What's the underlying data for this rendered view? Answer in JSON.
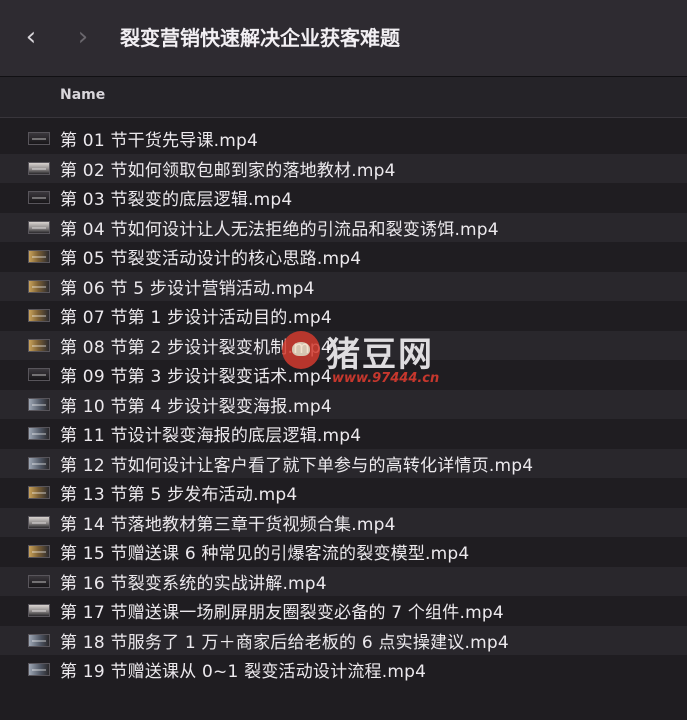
{
  "window": {
    "title": "裂变营销快速解决企业获客难题",
    "back_icon": "chevron-left-icon",
    "forward_icon": "chevron-right-icon"
  },
  "columns": {
    "name": "Name"
  },
  "files": [
    {
      "name": "第 01 节干货先导课.mp4",
      "thumb": "dark"
    },
    {
      "name": "第 02 节如何领取包邮到家的落地教材.mp4",
      "thumb": "light"
    },
    {
      "name": "第 03 节裂变的底层逻辑.mp4",
      "thumb": "dark"
    },
    {
      "name": "第 04 节如何设计让人无法拒绝的引流品和裂变诱饵.mp4",
      "thumb": "light"
    },
    {
      "name": "第 05 节裂变活动设计的核心思路.mp4",
      "thumb": "warm"
    },
    {
      "name": "第 06 节 5 步设计营销活动.mp4",
      "thumb": "warm"
    },
    {
      "name": "第 07 节第 1 步设计活动目的.mp4",
      "thumb": "warm"
    },
    {
      "name": "第 08 节第 2 步设计裂变机制.mp4",
      "thumb": "warm"
    },
    {
      "name": "第 09 节第 3 步设计裂变话术.mp4",
      "thumb": "dark"
    },
    {
      "name": "第 10 节第 4 步设计裂变海报.mp4",
      "thumb": "slate"
    },
    {
      "name": "第 11 节设计裂变海报的底层逻辑.mp4",
      "thumb": "slate"
    },
    {
      "name": "第 12 节如何设计让客户看了就下单参与的高转化详情页.mp4",
      "thumb": "slate"
    },
    {
      "name": "第 13 节第 5 步发布活动.mp4",
      "thumb": "warm"
    },
    {
      "name": "第 14 节落地教材第三章干货视频合集.mp4",
      "thumb": "light"
    },
    {
      "name": "第 15 节赠送课 6 种常见的引爆客流的裂变模型.mp4",
      "thumb": "warm"
    },
    {
      "name": "第 16 节裂变系统的实战讲解.mp4",
      "thumb": "dark"
    },
    {
      "name": "第 17 节赠送课一场刷屏朋友圈裂变必备的 7 个组件.mp4",
      "thumb": "light"
    },
    {
      "name": "第 18 节服务了 1 万＋商家后给老板的 6 点实操建议.mp4",
      "thumb": "slate"
    },
    {
      "name": "第 19 节赠送课从 0~1 裂变活动设计流程.mp4",
      "thumb": "slate"
    }
  ],
  "watermark": {
    "text": "猪豆网",
    "url": "www.97444.cn"
  }
}
